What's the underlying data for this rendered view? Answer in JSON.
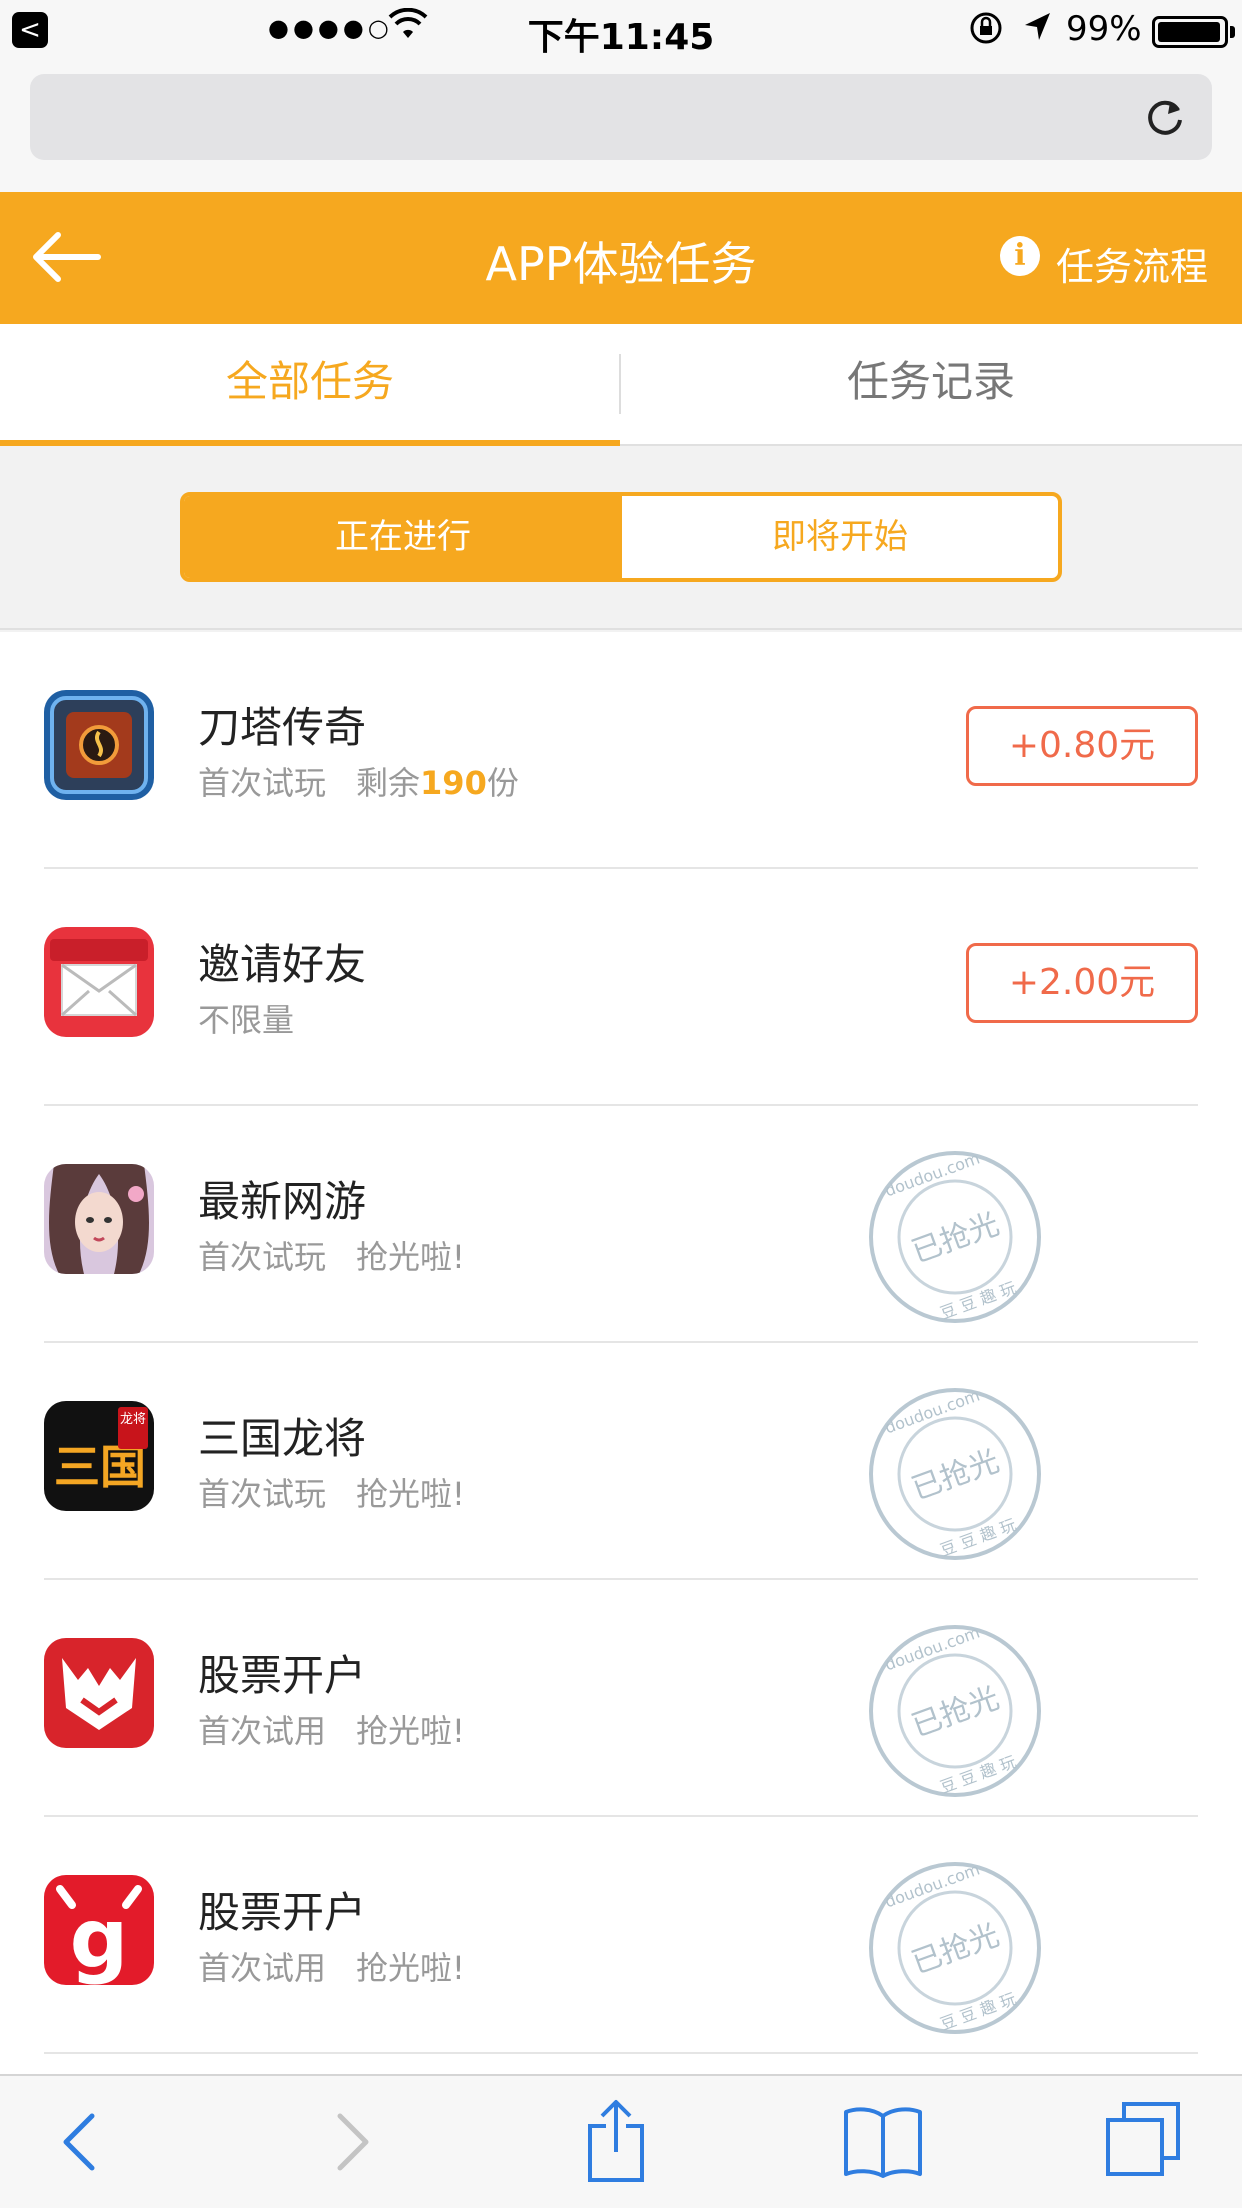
{
  "status_bar": {
    "back_badge": "<",
    "signal": "●●●●○",
    "time": "下午11:45",
    "battery": "99%"
  },
  "url_bar": {
    "address": "",
    "reload_icon": "reload-icon"
  },
  "header": {
    "title": "APP体验任务",
    "info_glyph": "i",
    "flow_label": "任务流程"
  },
  "tabs": [
    {
      "label": "全部任务",
      "active": true
    },
    {
      "label": "任务记录",
      "active": false
    }
  ],
  "segment": [
    {
      "label": "正在进行",
      "active": true
    },
    {
      "label": "即将开始",
      "active": false
    }
  ],
  "tasks": [
    {
      "name": "刀塔传奇",
      "sub_a": "首次试玩",
      "sub_b": "剩余",
      "count": "190",
      "unit": "份",
      "reward": "+0.80元",
      "sold_out": false
    },
    {
      "name": "邀请好友",
      "sub_a": "不限量",
      "reward": "+2.00元",
      "sold_out": false
    },
    {
      "name": "最新网游",
      "sub_a": "首次试玩",
      "sub_b": "抢光啦!",
      "sold_out": true
    },
    {
      "name": "三国龙将",
      "sub_a": "首次试玩",
      "sub_b": "抢光啦!",
      "sold_out": true
    },
    {
      "name": "股票开户",
      "sub_a": "首次试用",
      "sub_b": "抢光啦!",
      "sold_out": true
    },
    {
      "name": "股票开户",
      "sub_a": "首次试用",
      "sub_b": "抢光啦!",
      "sold_out": true
    }
  ],
  "stamp": {
    "text": "已抢光",
    "arc_top": "doudou.com",
    "arc_bottom": "豆 豆 趣 玩"
  },
  "icon_text": {
    "sanguo_main": "三国",
    "sanguo_tag": "龙将",
    "stock2": "g"
  },
  "colors": {
    "accent": "#f6a81f",
    "reward": "#f06a4a",
    "ios_blue": "#2f7de0"
  }
}
